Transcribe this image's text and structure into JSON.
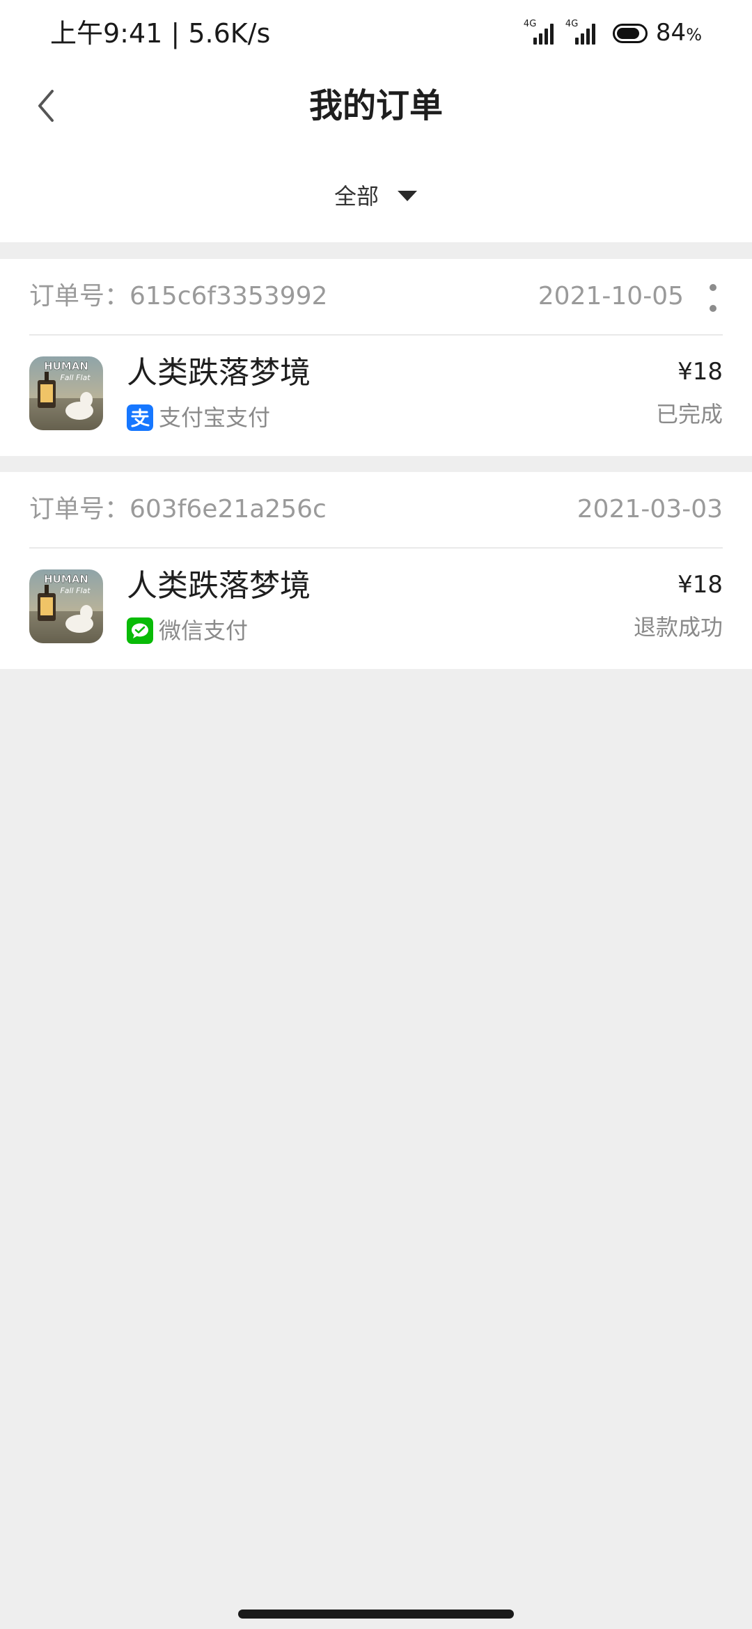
{
  "status_bar": {
    "time": "上午9:41",
    "speed": "5.6K/s",
    "network_1": "4G",
    "network_2": "4G",
    "battery_level": 84,
    "battery_value": "84",
    "battery_unit": "%"
  },
  "header": {
    "title": "我的订单"
  },
  "filter": {
    "selected": "全部"
  },
  "orders": [
    {
      "order_no": "订单号：615c6f3353992",
      "date": "2021-10-05",
      "game_name": "人类跌落梦境",
      "payment_method": "支付宝支付",
      "price": "¥18",
      "status": "已完成"
    },
    {
      "order_no": "订单号：603f6e21a256c",
      "date": "2021-03-03",
      "game_name": "人类跌落梦境",
      "payment_method": "微信支付",
      "price": "¥18",
      "status": "退款成功"
    }
  ],
  "game_icon": {
    "logo_line_1": "HUMAN",
    "logo_line_2": "Fall Flat"
  },
  "colors": {
    "alipay": "#1677ff",
    "wechat": "#09bb07",
    "page_background": "#eeeeee",
    "text_secondary": "#9a9a9a"
  }
}
